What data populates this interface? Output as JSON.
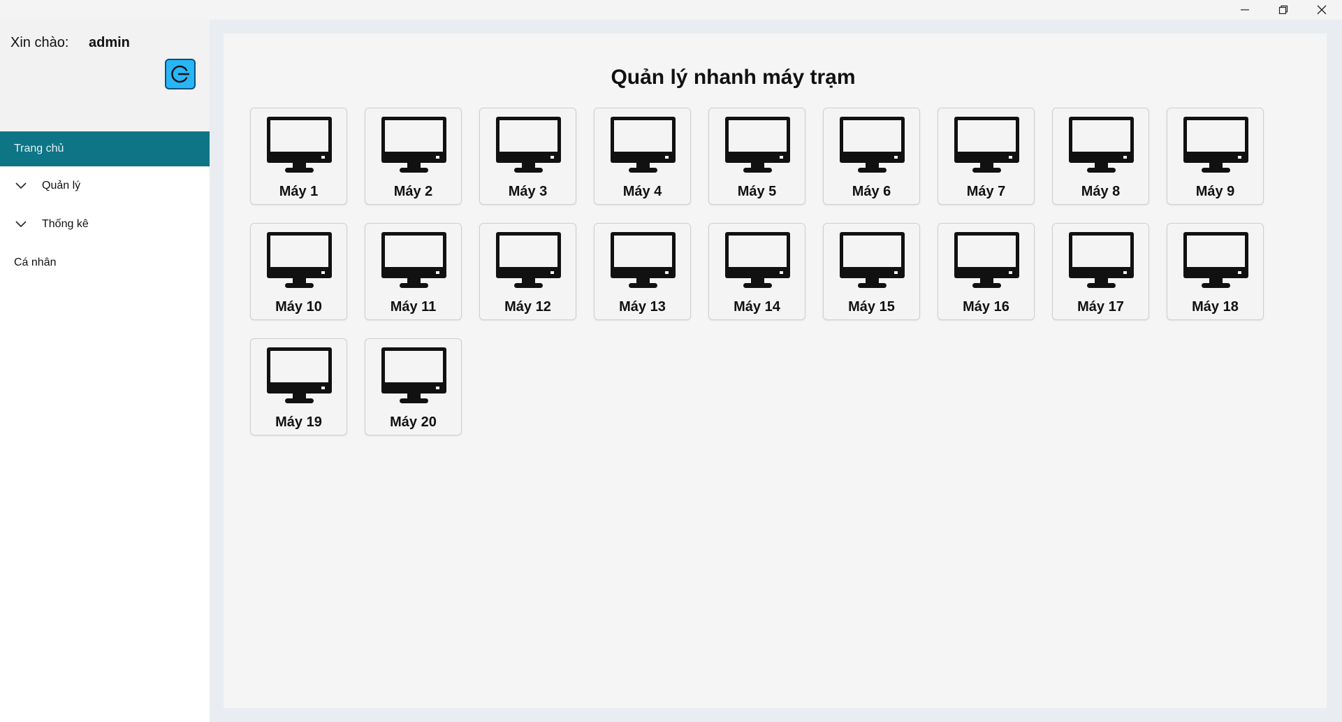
{
  "window": {
    "buttons": [
      "minimize-icon",
      "restore-icon",
      "close-icon"
    ]
  },
  "sidebar": {
    "greeting": "Xin chào:",
    "username": "admin",
    "logout_icon": "logout-icon",
    "logout_color": "#29b6f6",
    "items": [
      {
        "label": "Trang chủ",
        "active": true,
        "expandable": false
      },
      {
        "label": "Quản lý",
        "active": false,
        "expandable": true
      },
      {
        "label": "Thống kê",
        "active": false,
        "expandable": true
      },
      {
        "label": "Cá nhân",
        "active": false,
        "expandable": false
      }
    ],
    "active_color": "#0e7586"
  },
  "main": {
    "title": "Quản lý nhanh máy trạm",
    "computer_icon": "desktop-monitor-icon",
    "machines": [
      "Máy 1",
      "Máy 2",
      "Máy 3",
      "Máy 4",
      "Máy 5",
      "Máy 6",
      "Máy 7",
      "Máy 8",
      "Máy 9",
      "Máy 10",
      "Máy 11",
      "Máy 12",
      "Máy 13",
      "Máy 14",
      "Máy 15",
      "Máy 16",
      "Máy 17",
      "Máy 18",
      "Máy 19",
      "Máy 20"
    ]
  }
}
